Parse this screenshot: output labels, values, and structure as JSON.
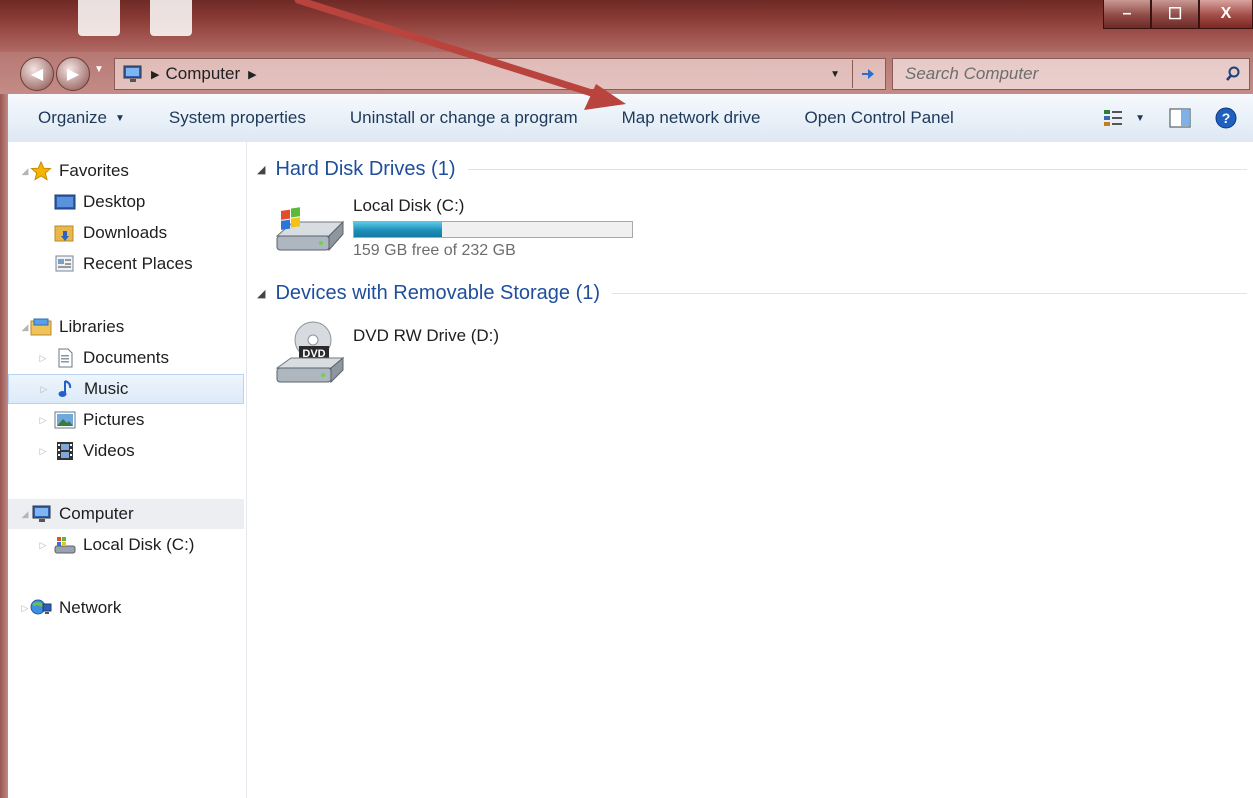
{
  "window": {
    "minimize_label": "–",
    "maximize_label": "☐",
    "close_label": "X"
  },
  "address": {
    "breadcrumb": "Computer",
    "search_placeholder": "Search Computer"
  },
  "toolbar": {
    "organize": "Organize",
    "system_properties": "System properties",
    "uninstall": "Uninstall or change a program",
    "map_network_drive": "Map network drive",
    "open_control_panel": "Open Control Panel"
  },
  "nav": {
    "favorites": "Favorites",
    "desktop": "Desktop",
    "downloads": "Downloads",
    "recent_places": "Recent Places",
    "libraries": "Libraries",
    "documents": "Documents",
    "music": "Music",
    "pictures": "Pictures",
    "videos": "Videos",
    "computer": "Computer",
    "local_disk": "Local Disk (C:)",
    "network": "Network"
  },
  "content": {
    "hard_disk_group": "Hard Disk Drives (1)",
    "local_disk_name": "Local Disk (C:)",
    "local_disk_usage_fraction": 0.315,
    "local_disk_free": "159 GB free of 232 GB",
    "removable_group": "Devices with Removable Storage (1)",
    "dvd_name": "DVD RW Drive (D:)",
    "dvd_badge": "DVD"
  },
  "colors": {
    "annotation_arrow": "#b8443d",
    "group_header": "#1e4e9c",
    "toolbar_text": "#1e395b"
  }
}
